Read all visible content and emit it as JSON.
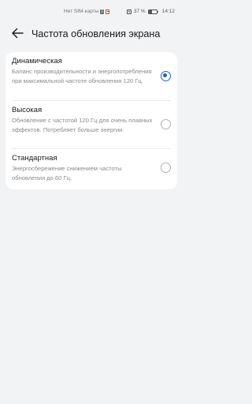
{
  "status_bar": {
    "carrier": "Нет SIM-карты",
    "battery": "37 %",
    "time": "14:12"
  },
  "header": {
    "title": "Частота обновления экрана"
  },
  "options": [
    {
      "title": "Динамическая",
      "description": "Баланс производительности и энергопотребления при максимальной частоте обновления 120 Гц.",
      "selected": true
    },
    {
      "title": "Высокая",
      "description": "Обновление с частотой 120 Гц для очень плавных эффектов. Потребляет больше энергии.",
      "selected": false
    },
    {
      "title": "Стандартная",
      "description": "Энергосбережение снижением частоты обновления до 60 Гц.",
      "selected": false
    }
  ],
  "colors": {
    "accent": "#1f5fd6",
    "background": "#f1f3f5",
    "card": "#ffffff"
  }
}
